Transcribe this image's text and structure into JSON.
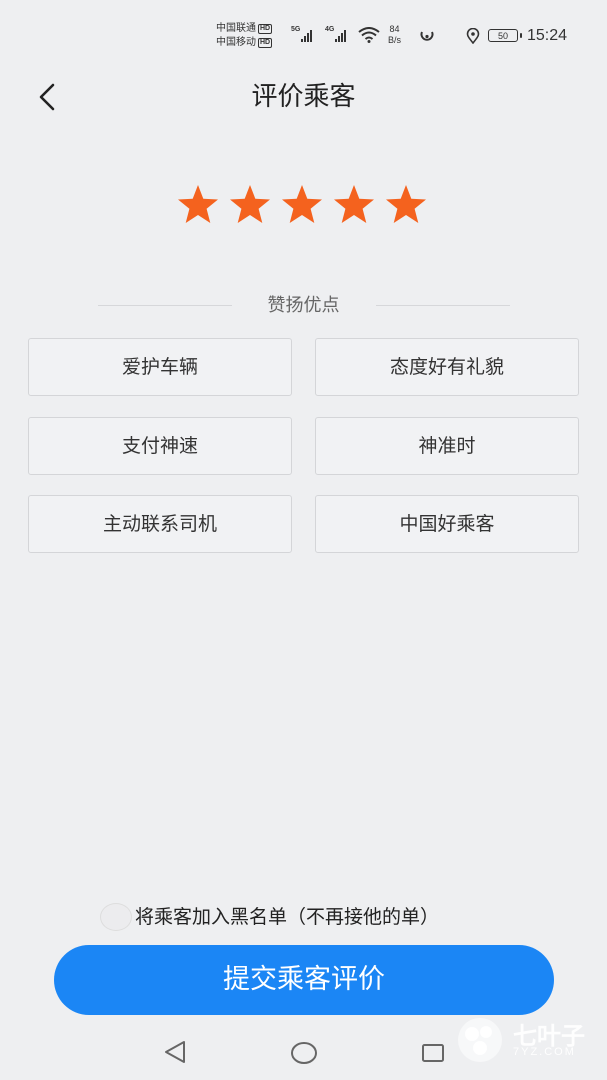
{
  "status_bar": {
    "carrier1": "中国联通",
    "carrier2": "中国移动",
    "hd": "HD",
    "sig1_gen": "5G",
    "sig2_gen": "4G",
    "speed_value": "84",
    "speed_unit": "B/s",
    "battery": "50",
    "time": "15:24"
  },
  "header": {
    "title": "评价乘客"
  },
  "rating": {
    "stars": 5,
    "max": 5,
    "color": "#f4621e"
  },
  "praise": {
    "title": "赞扬优点",
    "tags": [
      "爱护车辆",
      "态度好有礼貌",
      "支付神速",
      "神准时",
      "主动联系司机",
      "中国好乘客"
    ]
  },
  "blacklist": {
    "label": "将乘客加入黑名单（不再接他的单）",
    "checked": false
  },
  "submit": {
    "label": "提交乘客评价",
    "color": "#1b86f5"
  },
  "nav": {
    "icons": [
      "back-triangle-icon",
      "home-circle-icon",
      "recents-square-icon"
    ]
  },
  "watermark": {
    "text": "七叶子",
    "url": "7YZ.COM"
  }
}
